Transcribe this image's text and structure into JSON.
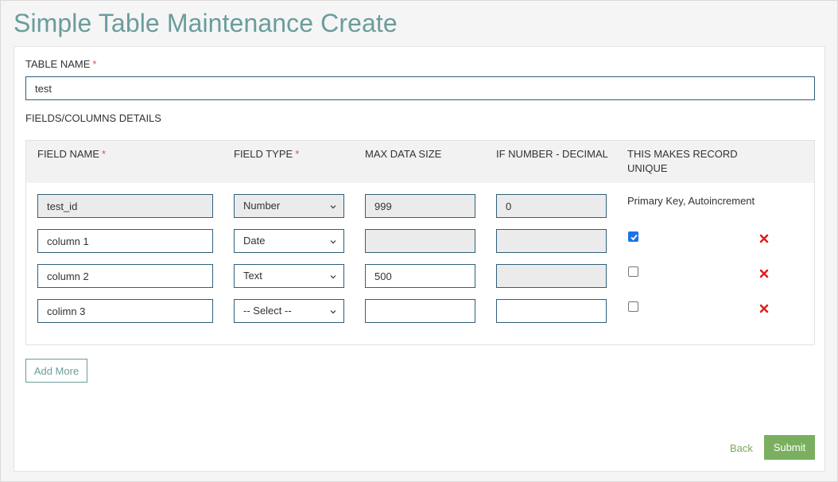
{
  "page": {
    "title": "Simple Table Maintenance Create"
  },
  "table_name": {
    "label": "TABLE NAME",
    "required_mark": "*",
    "value": "test"
  },
  "fields_section": {
    "label": "FIELDS/COLUMNS DETAILS",
    "headers": {
      "field_name": "FIELD NAME",
      "field_type": "FIELD TYPE",
      "max_data_size": "MAX DATA SIZE",
      "decimal": "IF NUMBER - DECIMAL",
      "unique": "THIS MAKES RECORD UNIQUE",
      "required_mark": "*"
    },
    "rows": [
      {
        "field_name": "test_id",
        "field_type": "Number",
        "max_data_size": "999",
        "decimal": "0",
        "unique_text": "Primary Key, Autoincrement"
      },
      {
        "field_name": "column 1",
        "field_type": "Date",
        "max_data_size": "",
        "decimal": "",
        "unique_checked": true
      },
      {
        "field_name": "column 2",
        "field_type": "Text",
        "max_data_size": "500",
        "decimal": "",
        "unique_checked": false
      },
      {
        "field_name": "colimn 3",
        "field_type": "-- Select --",
        "max_data_size": "",
        "decimal": "",
        "unique_checked": false
      }
    ]
  },
  "actions": {
    "add_more": "Add More",
    "back": "Back",
    "submit": "Submit"
  },
  "colors": {
    "title": "#6b9c9c",
    "required": "#d9534f",
    "delete": "#e02020",
    "submit": "#7aaf5f",
    "input_border": "#2f5f7a"
  },
  "icons": {
    "delete": "close-x-icon",
    "chevron": "chevron-down-icon",
    "check": "checkmark-icon"
  }
}
